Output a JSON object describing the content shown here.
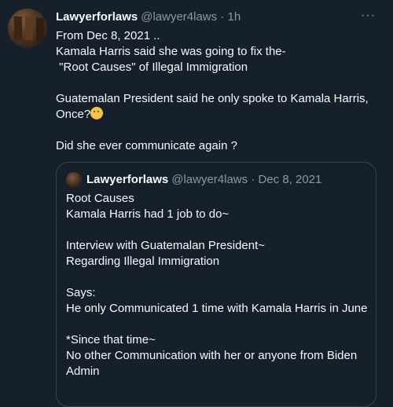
{
  "tweet": {
    "name": "Lawyerforlaws",
    "handle": "@lawyer4laws · 1h",
    "more": "···",
    "lines": [
      "From Dec 8, 2021 ..",
      "Kamala Harris said she was going to fix the-",
      " \"Root Causes\" of Illegal Immigration",
      " ",
      "Guatemalan President said he only spoke to Kamala Harris,",
      "Once?",
      " ",
      "Did she ever communicate again ?"
    ],
    "emoji": "thinking-face-icon"
  },
  "quote": {
    "name": "Lawyerforlaws",
    "handle": "@lawyer4laws · Dec 8, 2021",
    "lines": [
      "Root Causes",
      "Kamala Harris had 1 job to do~",
      " ",
      "Interview with Guatemalan President~",
      "Regarding Illegal Immigration",
      " ",
      "Says:",
      "He only Communicated 1 time with Kamala Harris in June",
      " ",
      "*Since that time~",
      "No other Communication with her or anyone from Biden",
      "Admin"
    ]
  }
}
